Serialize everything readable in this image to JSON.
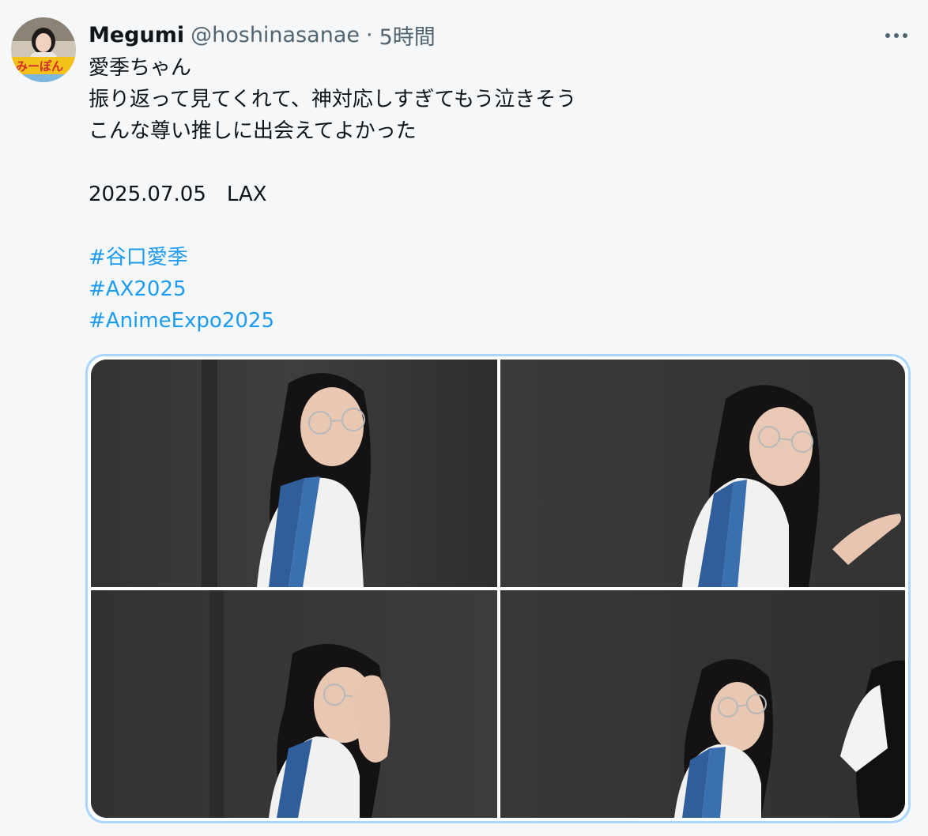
{
  "author": {
    "name": "Megumi",
    "handle": "@hoshinasanae",
    "separator": "·",
    "time": "5時間",
    "avatar_banner_text": "みーぽん"
  },
  "menu_icon": "more-horizontal-icon",
  "text_lines": [
    "愛季ちゃん",
    "振り返って見てくれて、神対応しすぎてもう泣きそう",
    "こんな尊い推しに出会えてよかった"
  ],
  "date_location": "2025.07.05　LAX",
  "hashtags": [
    "#谷口愛季",
    "#AX2025",
    "#AnimeExpo2025"
  ],
  "colors": {
    "hashtag": "#1d9bf0",
    "text": "#0f1419",
    "secondary": "#536471",
    "media_border": "#a9d5ff",
    "background": "#f5f7f8"
  }
}
